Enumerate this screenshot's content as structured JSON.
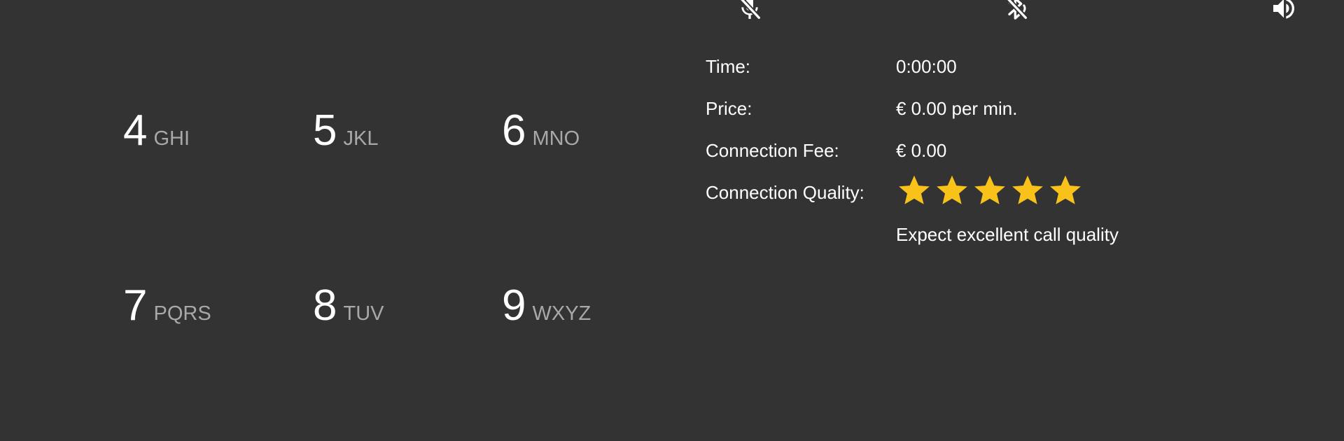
{
  "colors": {
    "background": "#333333",
    "text": "#ffffff",
    "letters": "#a8a8a8",
    "star": "#F9C21A"
  },
  "controls": {
    "mute_icon": "microphone-off-icon",
    "bluetooth_icon": "bluetooth-audio-icon",
    "speaker_icon": "speaker-icon"
  },
  "dialpad": {
    "keys": [
      {
        "digit": "4",
        "letters": "GHI"
      },
      {
        "digit": "5",
        "letters": "JKL"
      },
      {
        "digit": "6",
        "letters": "MNO"
      },
      {
        "digit": "7",
        "letters": "PQRS"
      },
      {
        "digit": "8",
        "letters": "TUV"
      },
      {
        "digit": "9",
        "letters": "WXYZ"
      }
    ]
  },
  "call_info": {
    "time_label": "Time:",
    "time_value": "0:00:00",
    "price_label": "Price:",
    "price_value": "€ 0.00 per min.",
    "fee_label": "Connection Fee:",
    "fee_value": "€ 0.00",
    "quality_label": "Connection Quality:",
    "quality_rating": 5,
    "quality_max": 5,
    "quality_text": "Expect excellent call quality"
  }
}
